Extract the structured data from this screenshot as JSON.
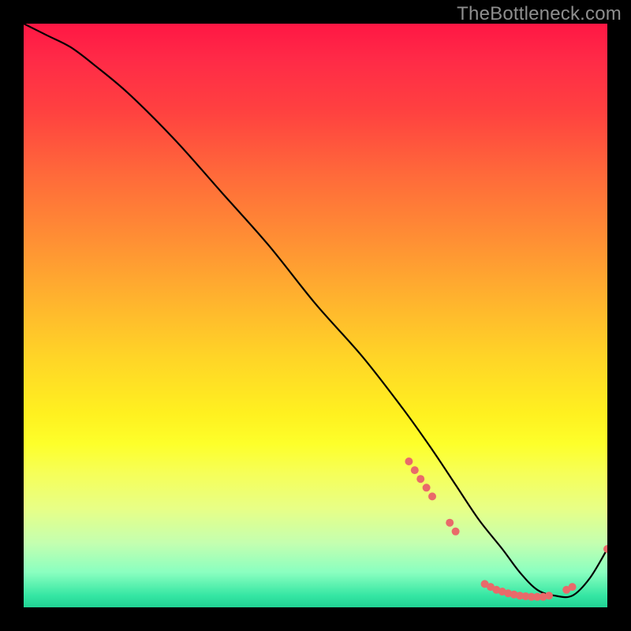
{
  "watermark": "TheBottleneck.com",
  "chart_data": {
    "type": "line",
    "title": "",
    "xlabel": "",
    "ylabel": "",
    "xlim": [
      0,
      100
    ],
    "ylim": [
      0,
      100
    ],
    "grid": false,
    "legend": false,
    "series": [
      {
        "name": "bottleneck-curve",
        "stroke": "#000000",
        "x": [
          0,
          4,
          8,
          12,
          18,
          26,
          34,
          42,
          50,
          58,
          65,
          70,
          74,
          78,
          82,
          85,
          88,
          91,
          94,
          97,
          100
        ],
        "y": [
          100,
          98,
          96,
          93,
          88,
          80,
          71,
          62,
          52,
          43,
          34,
          27,
          21,
          15,
          10,
          6,
          3,
          2,
          2,
          5,
          10
        ]
      }
    ],
    "scatter": {
      "name": "highlight-points",
      "color": "#e96a6a",
      "radius": 5,
      "points": [
        {
          "x": 66,
          "y": 25
        },
        {
          "x": 67,
          "y": 23.5
        },
        {
          "x": 68,
          "y": 22
        },
        {
          "x": 69,
          "y": 20.5
        },
        {
          "x": 70,
          "y": 19
        },
        {
          "x": 73,
          "y": 14.5
        },
        {
          "x": 74,
          "y": 13
        },
        {
          "x": 79,
          "y": 4
        },
        {
          "x": 80,
          "y": 3.5
        },
        {
          "x": 81,
          "y": 3
        },
        {
          "x": 82,
          "y": 2.7
        },
        {
          "x": 83,
          "y": 2.4
        },
        {
          "x": 84,
          "y": 2.2
        },
        {
          "x": 85,
          "y": 2.0
        },
        {
          "x": 86,
          "y": 1.9
        },
        {
          "x": 87,
          "y": 1.8
        },
        {
          "x": 88,
          "y": 1.8
        },
        {
          "x": 89,
          "y": 1.8
        },
        {
          "x": 90,
          "y": 2.0
        },
        {
          "x": 93,
          "y": 3.0
        },
        {
          "x": 94,
          "y": 3.5
        },
        {
          "x": 100,
          "y": 10
        }
      ]
    }
  }
}
